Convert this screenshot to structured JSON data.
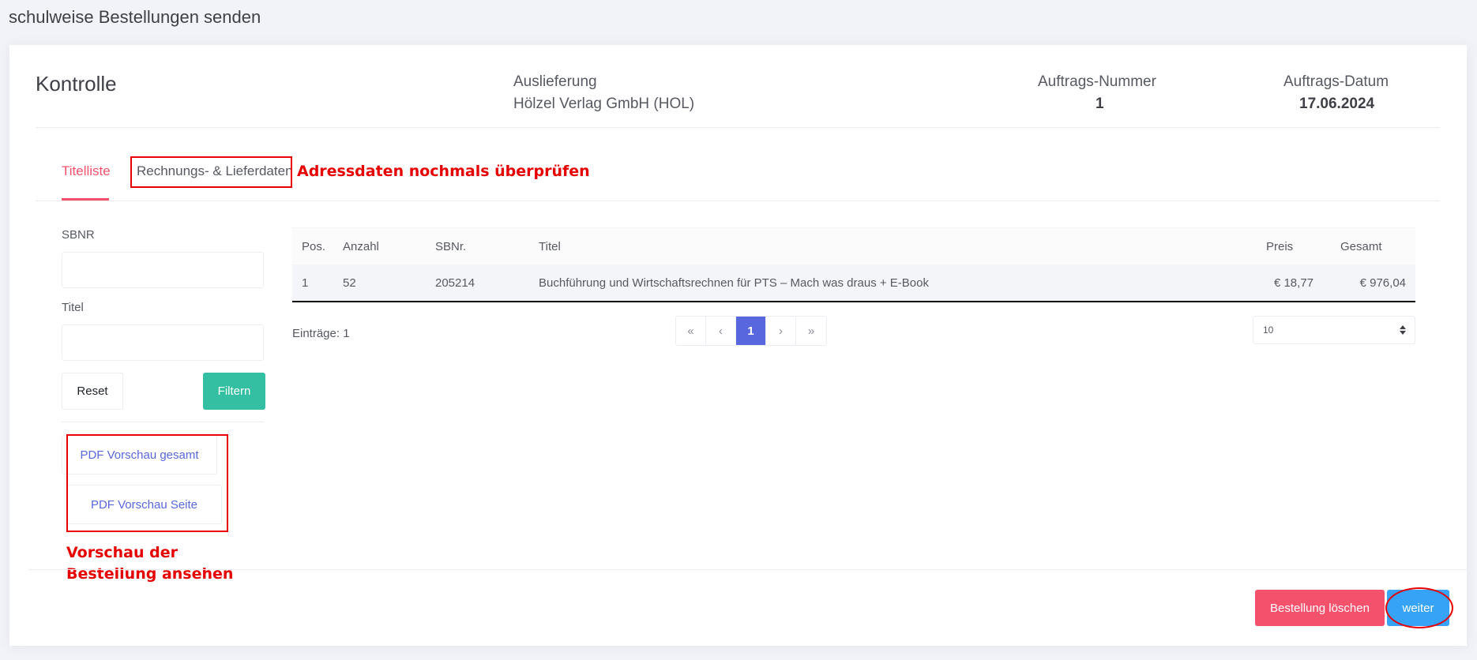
{
  "page": {
    "title": "schulweise Bestellungen senden"
  },
  "header": {
    "title": "Kontrolle",
    "auslieferung_label": "Auslieferung",
    "auslieferung_value": "Hölzel Verlag GmbH (HOL)",
    "auftrag_nr_label": "Auftrags-Nummer",
    "auftrag_nr_value": "1",
    "auftrag_datum_label": "Auftrags-Datum",
    "auftrag_datum_value": "17.06.2024"
  },
  "tabs": [
    {
      "label": "Titelliste",
      "active": true
    },
    {
      "label": "Rechnungs- & Lieferdaten",
      "active": false
    }
  ],
  "annotations": {
    "tab_note": "Adressdaten nochmals überprüfen",
    "pdf_note": "Vorschau der Bestellung ansehen",
    "color": "#e60000"
  },
  "filter": {
    "sbnr_label": "SBNR",
    "sbnr_value": "",
    "titel_label": "Titel",
    "titel_value": "",
    "reset_label": "Reset",
    "filter_label": "Filtern"
  },
  "pdf": {
    "gesamt_label": "PDF Vorschau gesamt",
    "seite_label": "PDF Vorschau Seite"
  },
  "table": {
    "columns": [
      "Pos.",
      "Anzahl",
      "SBNr.",
      "Titel",
      "Preis",
      "Gesamt"
    ],
    "rows": [
      [
        "1",
        "52",
        "205214",
        "Buchführung und Wirtschaftsrechnen für PTS – Mach was draus + E-Book",
        "€ 18,77",
        "€ 976,04"
      ]
    ]
  },
  "pagination": {
    "entries_label": "Einträge: 1",
    "first": "«",
    "prev": "‹",
    "current": "1",
    "next": "›",
    "last": "»",
    "page_size": "10"
  },
  "footer": {
    "delete_label": "Bestellung löschen",
    "next_label": "weiter"
  },
  "colors": {
    "accent_tab": "#f4516c",
    "filter_button": "#34bfa3",
    "pager_active": "#5867dd",
    "delete_button": "#f4516c",
    "next_button": "#36a3f7"
  }
}
